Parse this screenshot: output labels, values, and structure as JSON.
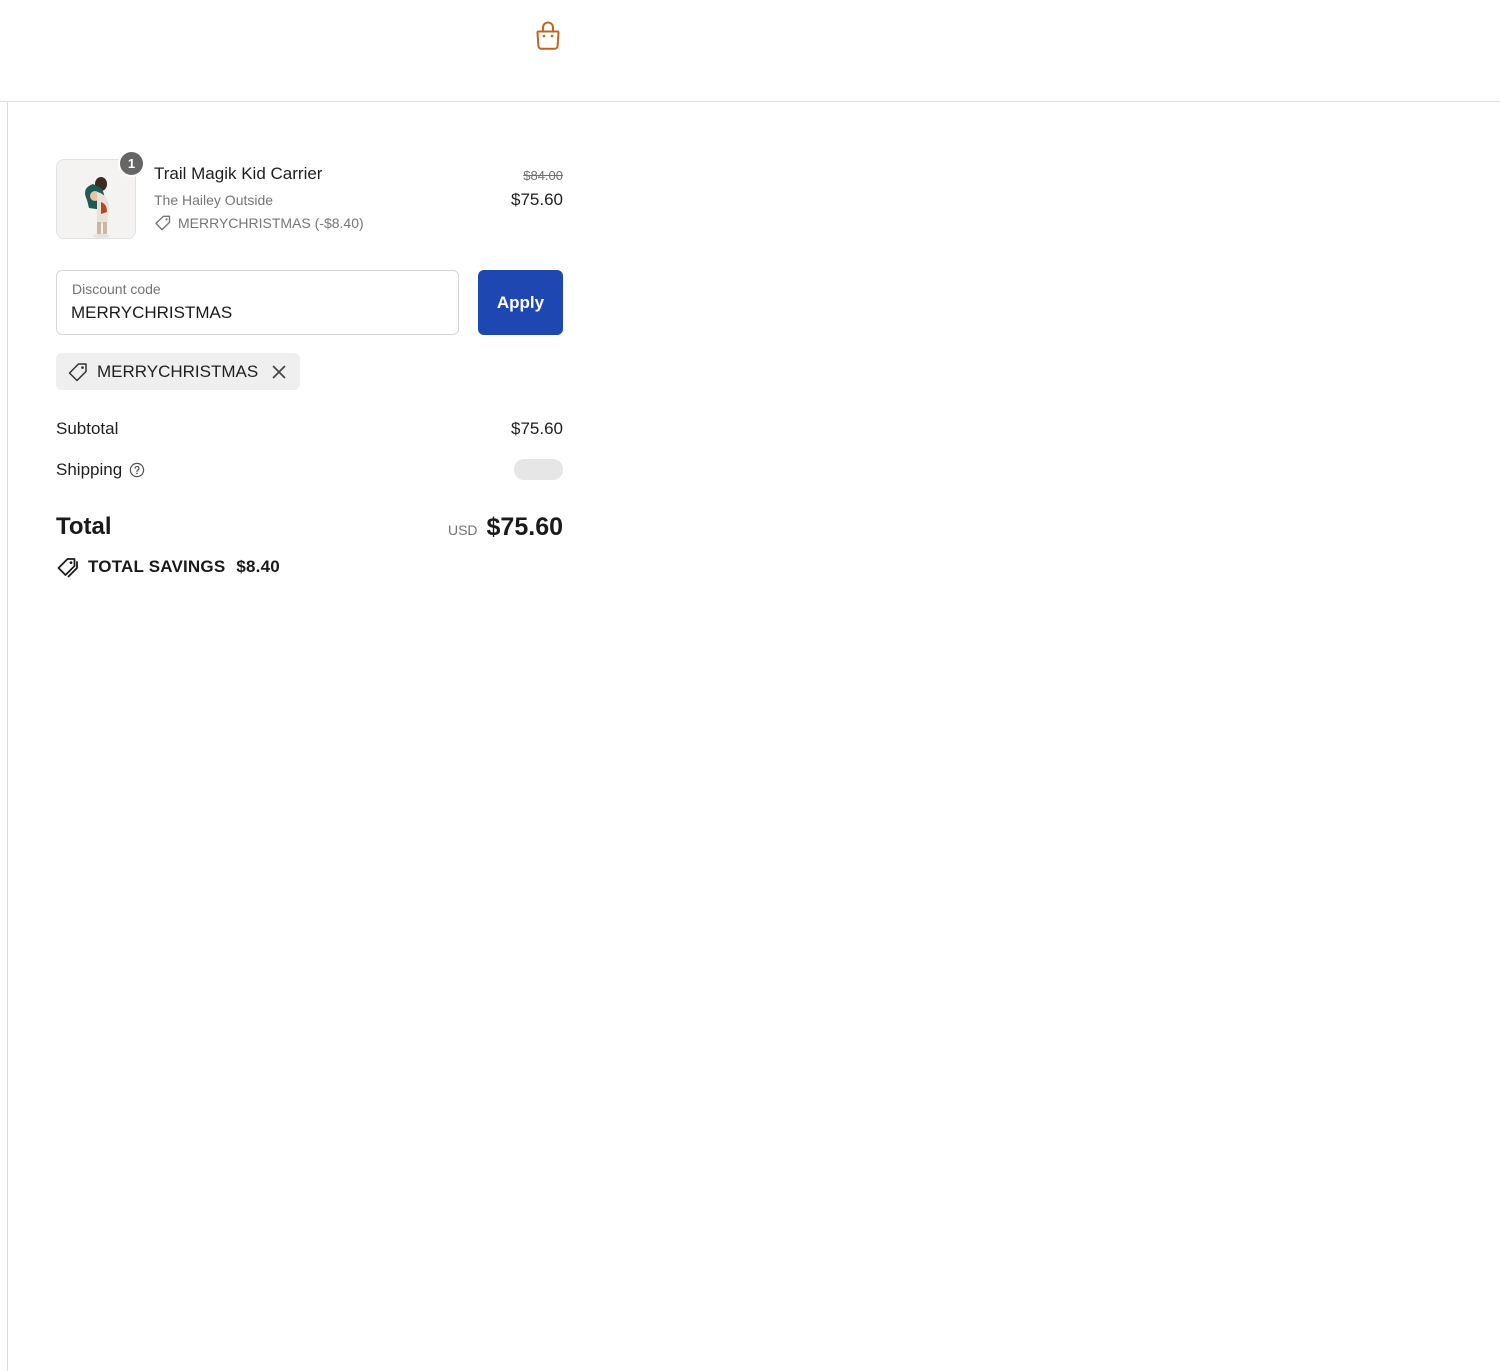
{
  "header": {
    "cart_icon": "shopping-bag-icon",
    "accent_color": "#c0651f"
  },
  "line_item": {
    "quantity": "1",
    "title": "Trail Magik Kid Carrier",
    "vendor": "The Hailey Outside",
    "discount_text": "MERRYCHRISTMAS (-$8.40)",
    "compare_at_price": "$84.00",
    "price": "$75.60"
  },
  "discount": {
    "label": "Discount code",
    "value": "MERRYCHRISTMAS",
    "apply_label": "Apply",
    "button_color": "#1e47b2",
    "applied_code": "MERRYCHRISTMAS"
  },
  "totals": {
    "subtotal_label": "Subtotal",
    "subtotal_value": "$75.60",
    "shipping_label": "Shipping",
    "total_label": "Total",
    "currency": "USD",
    "total_value": "$75.60",
    "savings_label": "TOTAL SAVINGS",
    "savings_value": "$8.40"
  }
}
